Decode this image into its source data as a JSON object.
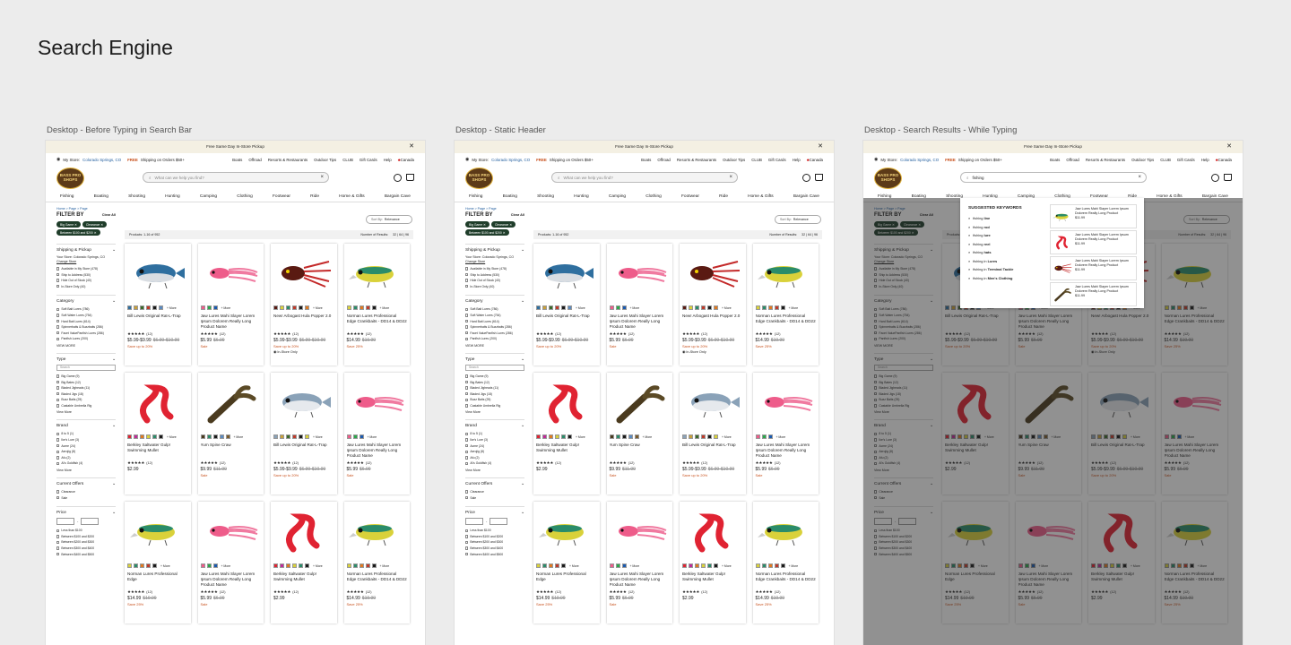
{
  "board_title": "Search Engine",
  "frames": [
    {
      "label": "Desktop - Before Typing in Search Bar",
      "search_text": "What can we help you find?",
      "typing": false,
      "crumbs": "Home  >  Page  >  Page"
    },
    {
      "label": "Desktop - Static Header",
      "search_text": "What can we help you find?",
      "typing": false,
      "crumbs": "Home  >  Page  >  Page"
    },
    {
      "label": "Desktop - Search Results - While Typing",
      "search_text": "fishing",
      "typing": true,
      "crumbs": "Home  >  Page  >  Page"
    }
  ],
  "header": {
    "promo": "Free Same Day In-Store Pickup",
    "close": "✕",
    "my_store_label": "My Store:",
    "my_store": "Colorado Springs, CO",
    "free": "FREE",
    "shipping": "Shipping on Orders $50+",
    "util_links": [
      "Boats",
      "Offroad",
      "Resorts & Restaurants",
      "Outdoor Tips",
      "CLUB",
      "Gift Cards",
      "Help"
    ],
    "country": "Canada",
    "logo_text": "BASS PRO SHOPS",
    "clear_icon": "×",
    "nav": [
      "Fishing",
      "Boating",
      "Shooting",
      "Hunting",
      "Camping",
      "Clothing",
      "Footwear",
      "Ride",
      "Home & Gifts",
      "Bargain Cave"
    ]
  },
  "filters": {
    "title": "FILTER BY",
    "clear_all": "Clear All",
    "chips": [
      "Big Game ✕",
      "Clearance ✕",
      "Between $100 and $200 ✕"
    ],
    "shipping": {
      "title": "Shipping & Pickup",
      "store_text": "Your Store: Colorado Springs, CO",
      "change": "Change Store",
      "options": [
        "Available in My Store (478)",
        "Ship to Address (530)",
        "Hide Out of Stock (40)",
        "In-Store Only (40)"
      ]
    },
    "category": {
      "title": "Category",
      "options": [
        "Soft Bait Lures (786)",
        "Soft Water Lures (754)",
        "Hard Bait Lures (614)",
        "Spinnerbaits & Buzzbaits (286)",
        "Facet ValuePanfish Lures (286)",
        "Panfish Lures (200)"
      ],
      "more": "VIEW MORE"
    },
    "type": {
      "title": "Type",
      "search": "Search",
      "options": [
        "Big Game (9)",
        "Big Bates (12)",
        "Bladed Jigheads (11)",
        "Bladed Jigs (18)",
        "Buzz Baits (25)",
        "Castable Umbrella Rig"
      ],
      "more": "View More"
    },
    "brand": {
      "title": "Brand",
      "options": [
        "8 to 5 (1)",
        "Ike's Lure (3)",
        "Acme (24)",
        "Aerojig (8)",
        "Afu (2)",
        "Al's Goldfish (4)"
      ],
      "more": "View More"
    },
    "offers": {
      "title": "Current Offers",
      "options": [
        "Clearance",
        "Sale"
      ]
    },
    "price": {
      "title": "Price",
      "dash": "-",
      "options": [
        "Less than $100",
        "Between $100 and $200",
        "Between $200 and $300",
        "Between $300 and $400",
        "Between $400 and $500"
      ]
    }
  },
  "results": {
    "sort_label": "Sort By:",
    "sort_value": "Relevance",
    "count": "Products: 1-16 of 952",
    "per_page_label": "Number of Results:",
    "per_page": "32 | 64 | 96",
    "more": "+ More",
    "stars": "★★★★★",
    "in_store": "In-Store Only"
  },
  "products": [
    {
      "name": "Bill Lewis Original Rat-L-Trap",
      "img": "crankbait-blue-icon",
      "reviews": "(12)",
      "price": "$5.99-$9.99",
      "was": "$6.99-$10.99",
      "note": "Save up to 20%",
      "in_store": false
    },
    {
      "name": "Jaw Lures Mahi Slayer Lorem Ipsum Dolorem Really Long Product Name",
      "img": "squid-lure-pink-icon",
      "reviews": "(12)",
      "price": "$5.99",
      "was": "$6.99",
      "note": "Sale",
      "in_store": false
    },
    {
      "name": "New! Arbogast Hula Popper 2.0",
      "img": "popper-red-icon",
      "reviews": "(12)",
      "price": "$5.99-$9.99",
      "was": "$6.99-$10.99",
      "note": "Save up to 20%",
      "in_store": true
    },
    {
      "name": "Norman Lures Professional Edge Crankbaits - DD14 & DD22",
      "img": "crankbait-yellow-icon",
      "reviews": "(12)",
      "price": "$14.99",
      "was": "$19.99",
      "note": "Save 25%",
      "in_store": false
    },
    {
      "name": "Berkley Saltwater Gulp! Swimming Mullet",
      "img": "grub-red-icon",
      "reviews": "(12)",
      "price": "$2.99",
      "was": "",
      "note": "",
      "in_store": false
    },
    {
      "name": "Yum Spine Craw",
      "img": "craw-brown-icon",
      "reviews": "(12)",
      "price": "$9.99",
      "was": "$11.99",
      "note": "Sale",
      "in_store": false
    },
    {
      "name": "Bill Lewis Original Rat-L-Trap",
      "img": "crankbait-silver-icon",
      "reviews": "(12)",
      "price": "$5.99-$9.99",
      "was": "$6.99-$10.99",
      "note": "Save up to 20%",
      "in_store": false
    },
    {
      "name": "Jaw Lures Mahi Slayer Lorem Ipsum Dolorem Really Long Product Name",
      "img": "squid-lure-pink-icon",
      "reviews": "(12)",
      "price": "$5.99",
      "was": "$6.99",
      "note": "Sale",
      "in_store": false
    },
    {
      "name": "Norman Lures Professional Edge",
      "img": "crankbait-yellow-icon",
      "reviews": "(12)",
      "price": "$14.99",
      "was": "$19.99",
      "note": "Save 25%",
      "in_store": false
    },
    {
      "name": "Jaw Lures Mahi Slayer Lorem Ipsum Dolorem Really Long Product Name",
      "img": "squid-lure-pink-icon",
      "reviews": "(12)",
      "price": "$5.99",
      "was": "$6.99",
      "note": "Sale",
      "in_store": false
    },
    {
      "name": "Berkley Saltwater Gulp! Swimming Mullet",
      "img": "grub-red-icon",
      "reviews": "(12)",
      "price": "$2.99",
      "was": "",
      "note": "",
      "in_store": false
    },
    {
      "name": "Norman Lures Professional Edge Crankbaits - DD14 & DD22",
      "img": "crankbait-yellow-icon",
      "reviews": "(12)",
      "price": "$14.99",
      "was": "$19.99",
      "note": "Save 25%",
      "in_store": false
    }
  ],
  "suggestions": {
    "title": "SUGGESTED KEYWORDS",
    "keywords": [
      {
        "pre": "fishing ",
        "bold": "line"
      },
      {
        "pre": "fishing ",
        "bold": "rod"
      },
      {
        "pre": "fishing ",
        "bold": "lure"
      },
      {
        "pre": "fishing ",
        "bold": "reel"
      },
      {
        "pre": "fishing ",
        "bold": "hats"
      },
      {
        "pre": "fishing in ",
        "bold": "Lures"
      },
      {
        "pre": "fishing in ",
        "bold": "Terminal Tackle"
      },
      {
        "pre": "fishing in ",
        "bold": "Men's Clothing"
      }
    ],
    "products": [
      {
        "name": "Jaw Lures Mahi Slayer Lorem Ipsum Dolorem Really Long Product",
        "price": "$11.99",
        "img": "crankbait-yellow-icon"
      },
      {
        "name": "Jaw Lures Mahi Slayer Lorem Ipsum Dolorem Really Long Product",
        "price": "$11.99",
        "img": "grub-red-icon"
      },
      {
        "name": "Jaw Lures Mahi Slayer Lorem Ipsum Dolorem Really Long Product",
        "price": "$11.99",
        "img": "popper-red-icon"
      },
      {
        "name": "Jaw Lures Mahi Slayer Lorem Ipsum Dolorem Really Long Product",
        "price": "$11.99",
        "img": "craw-brown-icon"
      }
    ]
  }
}
